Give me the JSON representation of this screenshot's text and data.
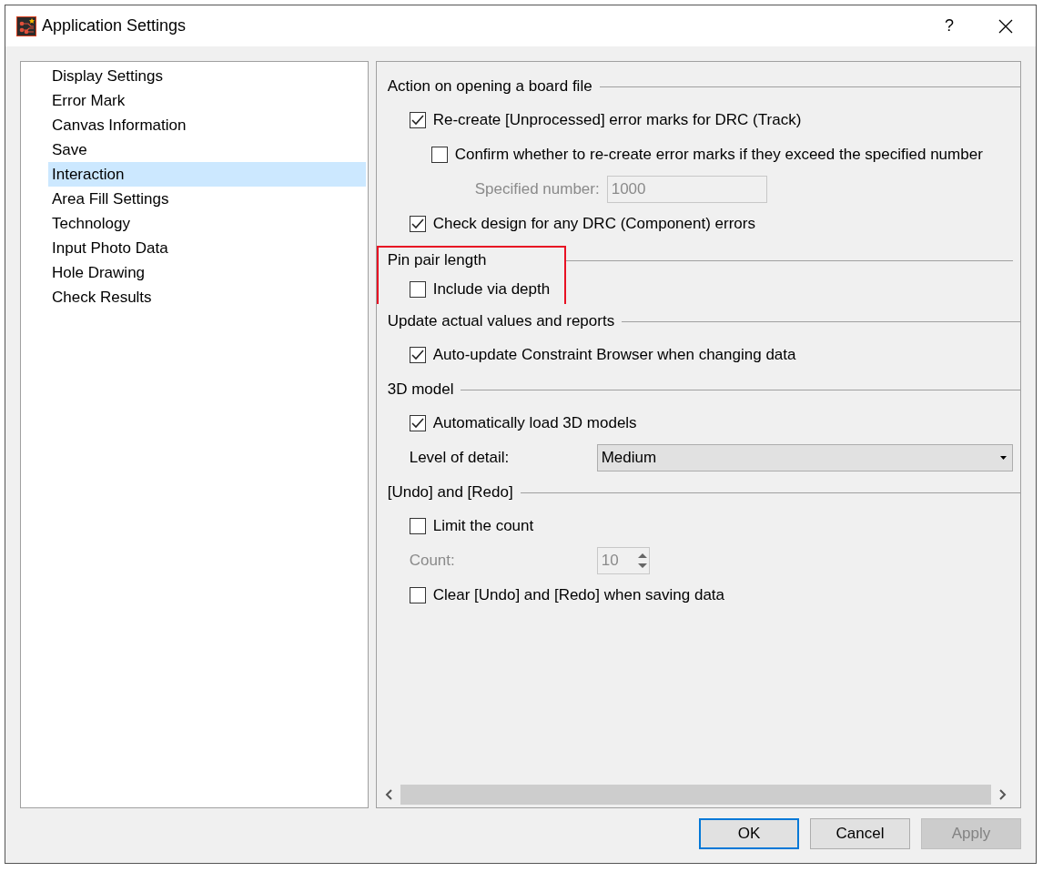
{
  "window": {
    "title": "Application Settings",
    "help": "?"
  },
  "sidebar": {
    "items": [
      {
        "label": "Display Settings",
        "selected": false
      },
      {
        "label": "Error Mark",
        "selected": false
      },
      {
        "label": "Canvas Information",
        "selected": false
      },
      {
        "label": "Save",
        "selected": false
      },
      {
        "label": "Interaction",
        "selected": true
      },
      {
        "label": "Area Fill Settings",
        "selected": false
      },
      {
        "label": "Technology",
        "selected": false
      },
      {
        "label": "Input Photo Data",
        "selected": false
      },
      {
        "label": "Hole Drawing",
        "selected": false
      },
      {
        "label": "Check Results",
        "selected": false
      }
    ]
  },
  "sections": [
    {
      "title": "Action on opening a board file",
      "highlighted": false,
      "items": [
        {
          "kind": "checkbox",
          "label": "Re-create [Unprocessed] error marks for DRC (Track)",
          "checked": true,
          "children": [
            {
              "kind": "checkbox",
              "label": "Confirm whether to re-create error marks if they exceed the specified number",
              "checked": false,
              "children": [
                {
                  "kind": "number",
                  "label": "Specified number:",
                  "value": "1000",
                  "disabled": true
                }
              ]
            }
          ]
        },
        {
          "kind": "checkbox",
          "label": "Check design for any DRC (Component) errors",
          "checked": true
        }
      ]
    },
    {
      "title": "Pin pair length",
      "highlighted": true,
      "items": [
        {
          "kind": "checkbox",
          "label": "Include via depth",
          "checked": false
        }
      ]
    },
    {
      "title": "Update actual values and reports",
      "highlighted": false,
      "items": [
        {
          "kind": "checkbox",
          "label": "Auto-update Constraint Browser when changing data",
          "checked": true
        }
      ]
    },
    {
      "title": "3D model",
      "highlighted": false,
      "items": [
        {
          "kind": "checkbox",
          "label": "Automatically load 3D models",
          "checked": true
        },
        {
          "kind": "dropdown",
          "label": "Level of detail:",
          "value": "Medium",
          "disabled": false
        }
      ]
    },
    {
      "title": "[Undo] and [Redo]",
      "highlighted": false,
      "items": [
        {
          "kind": "checkbox",
          "label": "Limit the count",
          "checked": false
        },
        {
          "kind": "spinner",
          "label": "Count:",
          "value": "10",
          "disabled": true
        },
        {
          "kind": "checkbox",
          "label": "Clear [Undo] and [Redo] when saving data",
          "checked": false
        }
      ]
    }
  ],
  "buttons": [
    {
      "label": "OK",
      "disabled": false,
      "default": true
    },
    {
      "label": "Cancel",
      "disabled": false,
      "default": false
    },
    {
      "label": "Apply",
      "disabled": true,
      "default": false
    }
  ]
}
